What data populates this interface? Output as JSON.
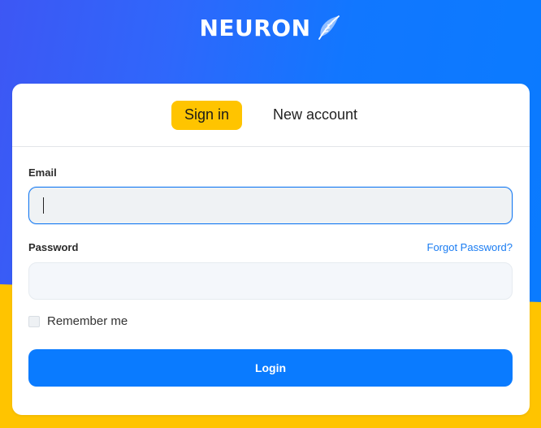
{
  "brand": {
    "name": "NEURON",
    "logo_icon": "feather-icon"
  },
  "colors": {
    "primary": "#0a7bff",
    "accent": "#ffc400",
    "link": "#1a7cf2"
  },
  "tabs": [
    {
      "label": "Sign in",
      "active": true
    },
    {
      "label": "New account",
      "active": false
    }
  ],
  "form": {
    "email": {
      "label": "Email",
      "value": "",
      "placeholder": ""
    },
    "password": {
      "label": "Password",
      "value": "",
      "placeholder": ""
    },
    "forgot_label": "Forgot Password?",
    "remember_label": "Remember me",
    "remember_checked": false,
    "submit_label": "Login"
  }
}
